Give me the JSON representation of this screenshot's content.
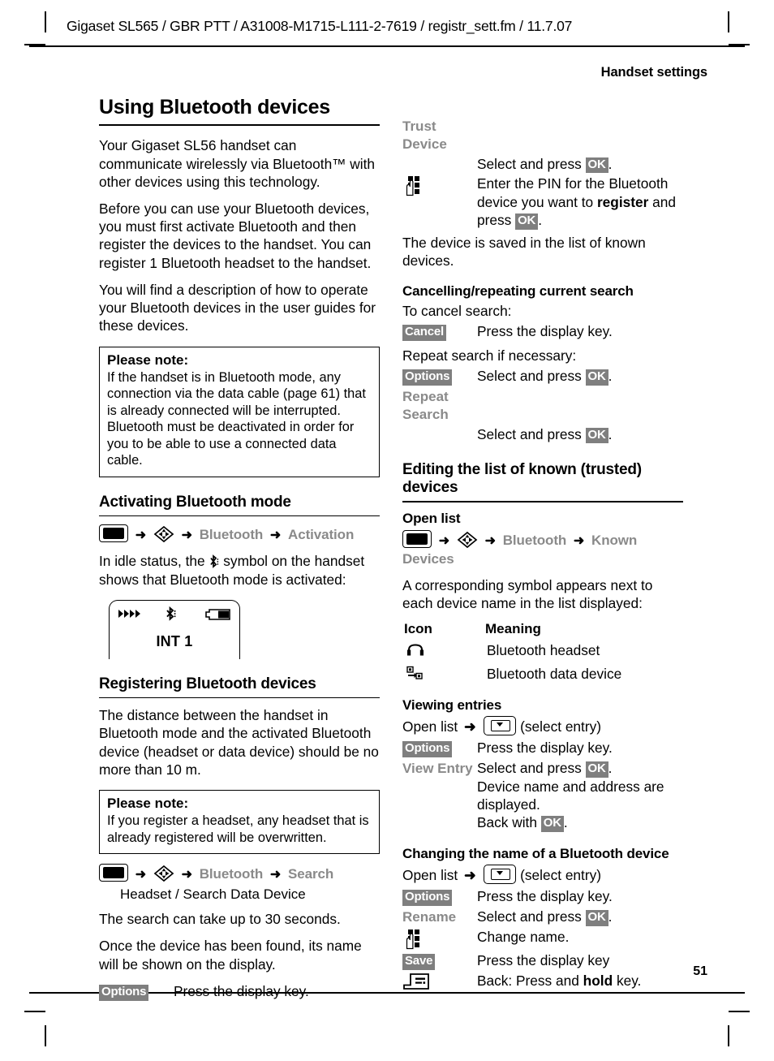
{
  "header": {
    "running_head": "Gigaset SL565 / GBR PTT / A31008-M1715-L111-2-7619 / registr_sett.fm / 11.7.07",
    "chapter_title": "Handset settings",
    "page_number": "51"
  },
  "colors": {
    "menu_grey": "#8a8a8a",
    "badge_bg": "#7f7f7f",
    "badge_fg": "#ffffff",
    "rule": "#000000"
  },
  "left_column": {
    "title": "Using Bluetooth devices",
    "paragraphs": [
      "Your Gigaset SL56 handset can communicate wirelessly via Bluetooth™ with other devices using this technology.",
      "Before you can use your Bluetooth devices, you must first activate Bluetooth and then register the devices to the handset. You can register 1 Bluetooth headset to the handset.",
      "You will find a description of how to operate your Bluetooth devices in the user guides for these devices."
    ],
    "note1": {
      "title": "Please note:",
      "body": "If the handset is in Bluetooth mode, any connection via the data cable (page 61) that is already connected will be interrupted. Bluetooth must be deactivated in order for you to be able to use a connected data cable."
    },
    "activating": {
      "heading": "Activating Bluetooth mode",
      "path": [
        "Bluetooth",
        "Activation"
      ],
      "intro_before": "In idle status, the",
      "intro_after": "symbol on the handset shows that Bluetooth mode is activated:",
      "handset_display": {
        "label": "INT 1"
      }
    },
    "registering": {
      "heading": "Registering Bluetooth devices",
      "intro": "The distance between the handset in Bluetooth mode and the activated Bluetooth device (headset or data device) should be no more than 10 m.",
      "note": {
        "title": "Please note:",
        "body": "If you register a headset, any headset that is already registered will be overwritten."
      },
      "path": [
        "Bluetooth",
        "Search"
      ],
      "path_line2": "Headset / Search Data Device",
      "search_time": "The search can take up to 30 seconds.",
      "found_text": "Once the device has been found, its name will be shown on the display.",
      "options_row": {
        "key": "Options",
        "desc": "Press the display key."
      }
    }
  },
  "right_column": {
    "trust_device": {
      "key": "Trust Device",
      "row1_desc_pre": "Select and press",
      "row1_badge": "OK",
      "row2_desc_pre": "Enter the PIN for the Bluetooth device you want to",
      "row2_bold": "register",
      "row2_desc_mid": "and press",
      "row2_badge": "OK",
      "saved_text": "The device is saved in the list of known devices."
    },
    "cancelling": {
      "heading": "Cancelling/repeating current search",
      "to_cancel": "To cancel search:",
      "cancel_row": {
        "key": "Cancel",
        "desc": "Press the display key."
      },
      "repeat_intro": "Repeat search if necessary:",
      "options_row": {
        "key": "Options",
        "desc_pre": "Select and press",
        "badge": "OK"
      },
      "repeat_search_row": {
        "key": "Repeat Search",
        "desc_pre": "Select and press",
        "badge": "OK"
      }
    },
    "editing": {
      "heading": "Editing the list of known (trusted) devices",
      "open_list_heading": "Open list",
      "path": [
        "Bluetooth",
        "Known Devices"
      ],
      "intro": "A corresponding symbol appears next to each device name in the list displayed:",
      "table": {
        "col_icon": "Icon",
        "col_meaning": "Meaning",
        "rows": [
          {
            "icon": "headset-icon",
            "meaning": "Bluetooth headset"
          },
          {
            "icon": "data-device-icon",
            "meaning": "Bluetooth data device"
          }
        ]
      }
    },
    "viewing": {
      "heading": "Viewing entries",
      "open_list_pre": "Open list",
      "open_list_post": "(select entry)",
      "options_row": {
        "key": "Options",
        "desc": "Press the display key."
      },
      "view_entry_row": {
        "key": "View Entry",
        "desc_pre": "Select and press",
        "badge1": "OK",
        "desc_line2": "Device name and address are displayed.",
        "desc_line3_pre": "Back with",
        "badge2": "OK"
      }
    },
    "changing_name": {
      "heading": "Changing the name of a Bluetooth device",
      "open_list_pre": "Open list",
      "open_list_post": "(select entry)",
      "options_row": {
        "key": "Options",
        "desc": "Press the display key."
      },
      "rename_row": {
        "key": "Rename",
        "desc_pre": "Select and press",
        "badge": "OK"
      },
      "keypad_row": {
        "icon": "keypad-icon",
        "desc": "Change name."
      },
      "save_row": {
        "key": "Save",
        "desc": "Press the display key"
      },
      "back_row": {
        "icon": "back-key-icon",
        "desc_pre": "Back: Press and",
        "desc_bold": "hold",
        "desc_post": "key."
      }
    }
  }
}
